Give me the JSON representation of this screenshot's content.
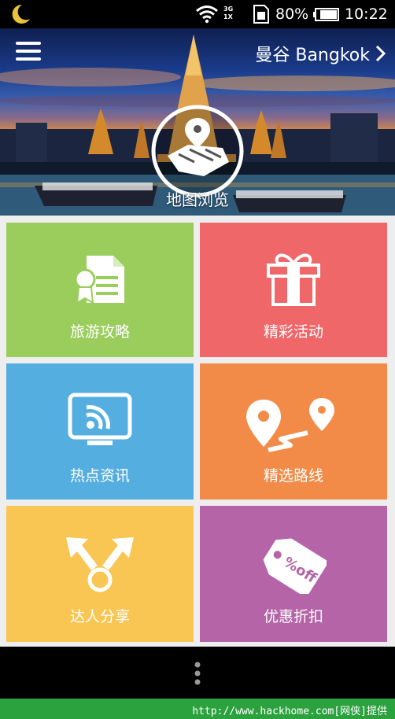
{
  "status_bar": {
    "network_top": "3G",
    "network_bottom": "1X",
    "battery": "80%",
    "time": "10:22",
    "icons": [
      "moon-icon",
      "wifi-icon",
      "sim-icon",
      "battery-icon"
    ]
  },
  "header": {
    "menu_icon": "hamburger-menu-icon",
    "city": "曼谷 Bangkok",
    "map_browse": "地图浏览"
  },
  "tiles": [
    {
      "label": "旅游攻略",
      "color": "#9acd5c",
      "icon": "guide-document-icon"
    },
    {
      "label": "精彩活动",
      "color": "#f0676a",
      "icon": "gift-box-icon"
    },
    {
      "label": "热点资讯",
      "color": "#55aee0",
      "icon": "tv-broadcast-icon"
    },
    {
      "label": "精选路线",
      "color": "#f28b48",
      "icon": "route-pins-icon"
    },
    {
      "label": "达人分享",
      "color": "#f9c653",
      "icon": "share-arrows-icon"
    },
    {
      "label": "优惠折扣",
      "color": "#b565a7",
      "icon": "discount-tag-icon"
    }
  ],
  "discount_tag_text": "%off",
  "watermark": "http://www.hackhome.com[网侠]提供"
}
